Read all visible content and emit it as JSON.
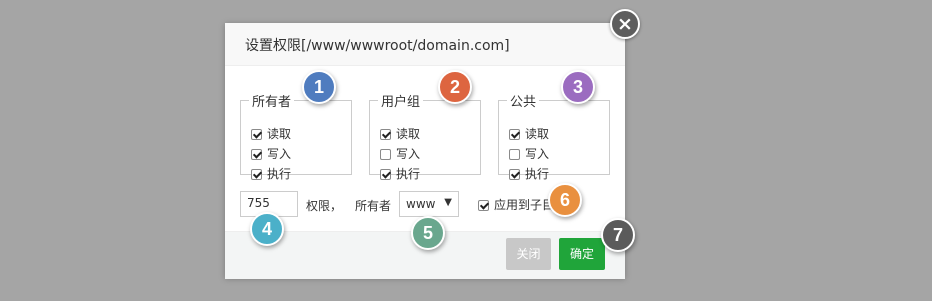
{
  "dialog": {
    "title": "设置权限[/www/wwwroot/domain.com]",
    "close_icon": "×"
  },
  "groups": [
    {
      "legend": "所有者",
      "items": [
        {
          "label": "读取",
          "checked": true
        },
        {
          "label": "写入",
          "checked": true
        },
        {
          "label": "执行",
          "checked": true
        }
      ]
    },
    {
      "legend": "用户组",
      "items": [
        {
          "label": "读取",
          "checked": true
        },
        {
          "label": "写入",
          "checked": false
        },
        {
          "label": "执行",
          "checked": true
        }
      ]
    },
    {
      "legend": "公共",
      "items": [
        {
          "label": "读取",
          "checked": true
        },
        {
          "label": "写入",
          "checked": false
        },
        {
          "label": "执行",
          "checked": true
        }
      ]
    }
  ],
  "permission": {
    "value": "755",
    "suffix_label": "权限，",
    "owner_label": "所有者",
    "owner_value": "www",
    "owner_arrow": "▼"
  },
  "apply_sub": {
    "label": "应用到子目",
    "checked": true
  },
  "buttons": {
    "close": "关闭",
    "ok": "确定"
  },
  "badges": [
    {
      "text": "1",
      "color": "#4f7cbf"
    },
    {
      "text": "2",
      "color": "#dd6540"
    },
    {
      "text": "3",
      "color": "#9b6cc0"
    },
    {
      "text": "4",
      "color": "#4bb0c9"
    },
    {
      "text": "5",
      "color": "#6aa78e"
    },
    {
      "text": "6",
      "color": "#e9903f"
    },
    {
      "text": "7",
      "color": "#5b5b5b"
    }
  ],
  "colors": {
    "overlay": "#a5a5a5",
    "ok_button": "#20a53a",
    "close_button": "#c8c8c8"
  }
}
